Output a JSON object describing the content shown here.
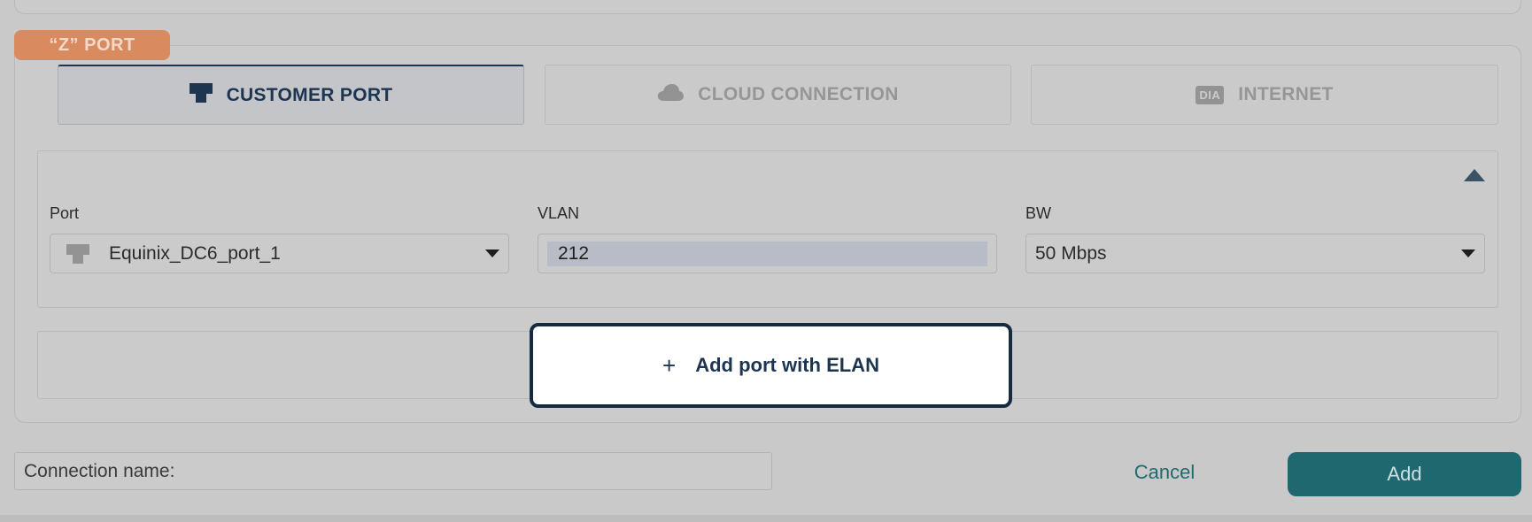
{
  "section": {
    "badge": "“Z” PORT"
  },
  "tabs": [
    {
      "label": "CUSTOMER PORT",
      "icon": "port-icon",
      "active": true
    },
    {
      "label": "CLOUD CONNECTION",
      "icon": "cloud-icon",
      "active": false
    },
    {
      "label": "INTERNET",
      "icon": "dia-icon",
      "icon_text": "DIA",
      "active": false
    }
  ],
  "fields": {
    "port": {
      "label": "Port",
      "value": "Equinix_DC6_port_1"
    },
    "vlan": {
      "label": "VLAN",
      "value": "212"
    },
    "bw": {
      "label": "BW",
      "value": "50 Mbps"
    }
  },
  "add_elan": {
    "plus": "+",
    "label": "Add port with ELAN"
  },
  "footer": {
    "connection_name": "Connection name:",
    "cancel": "Cancel",
    "add": "Add"
  },
  "colors": {
    "badge": "#d98a5f",
    "primary": "#1d3550",
    "add_button": "#1f6870",
    "overlay": "#c9c9c9"
  }
}
